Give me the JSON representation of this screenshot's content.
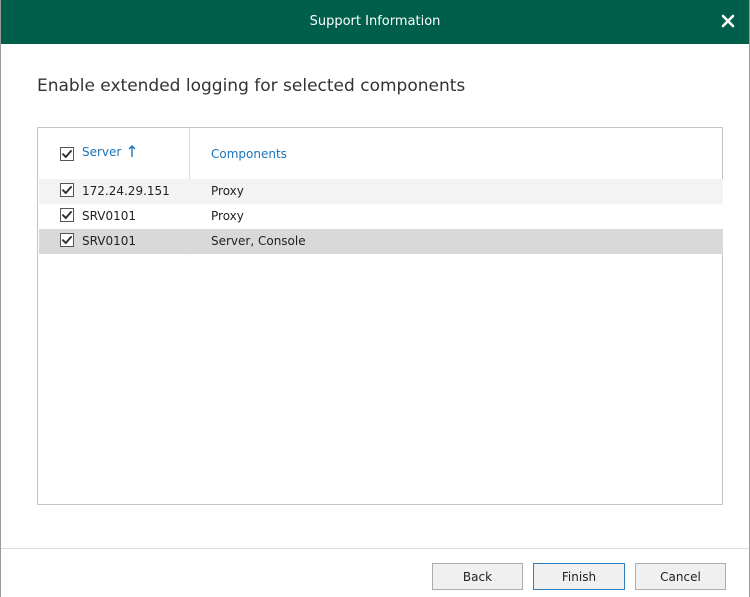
{
  "window": {
    "title": "Support Information",
    "close_icon": "close-icon"
  },
  "heading": "Enable extended logging for selected components",
  "table": {
    "header_checked": true,
    "columns": {
      "server": "Server",
      "server_sort": "ascending",
      "components": "Components"
    },
    "rows": [
      {
        "checked": true,
        "server": "172.24.29.151",
        "components": "Proxy",
        "selected": false
      },
      {
        "checked": true,
        "server": "SRV0101",
        "components": "Proxy",
        "selected": false
      },
      {
        "checked": true,
        "server": "SRV0101",
        "components": "Server, Console",
        "selected": true
      }
    ]
  },
  "buttons": {
    "back": "Back",
    "finish": "Finish",
    "cancel": "Cancel"
  },
  "colors": {
    "titlebar": "#005f4b",
    "header_link": "#1a73b8",
    "selected_row": "#d9d9d9",
    "alt_row": "#f3f3f3"
  }
}
